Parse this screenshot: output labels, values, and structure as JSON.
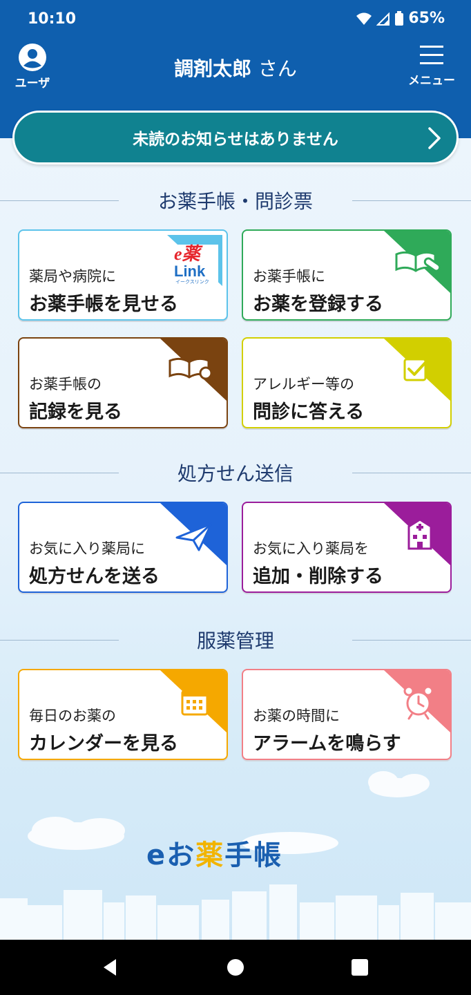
{
  "status": {
    "time": "10:10",
    "battery": "65%"
  },
  "header": {
    "user_label": "ユーザ",
    "username": "調剤太郎",
    "honorific": "さん",
    "menu_label": "メニュー"
  },
  "notice": {
    "text": "未読のお知らせはありません"
  },
  "sections": {
    "notebook": "お薬手帳・問診票",
    "prescription": "処方せん送信",
    "medication": "服薬管理"
  },
  "cards": {
    "show_notebook": {
      "line1": "薬局や病院に",
      "line2": "お薬手帳を見せる",
      "badge_top": "e薬",
      "badge_bottom": "Link",
      "badge_sub": "イークスリンク",
      "color": "#5cc3ea"
    },
    "register": {
      "line1": "お薬手帳に",
      "line2": "お薬を登録する",
      "color": "#2faa59"
    },
    "records": {
      "line1": "お薬手帳の",
      "line2": "記録を見る",
      "color": "#7a4310"
    },
    "questionnaire": {
      "line1": "アレルギー等の",
      "line2": "問診に答える",
      "color": "#d2cf00"
    },
    "send_rx": {
      "line1": "お気に入り薬局に",
      "line2": "処方せんを送る",
      "color": "#1e63d8"
    },
    "favorites": {
      "line1": "お気に入り薬局を",
      "line2": "追加・削除する",
      "color": "#9b1d9b"
    },
    "calendar": {
      "line1": "毎日のお薬の",
      "line2": "カレンダーを見る",
      "color": "#f5a800"
    },
    "alarm": {
      "line1": "お薬の時間に",
      "line2": "アラームを鳴らす",
      "color": "#f27f86"
    }
  },
  "logo": {
    "e": "e",
    "o": "お",
    "kusuri": "薬",
    "techo": "手帳"
  }
}
